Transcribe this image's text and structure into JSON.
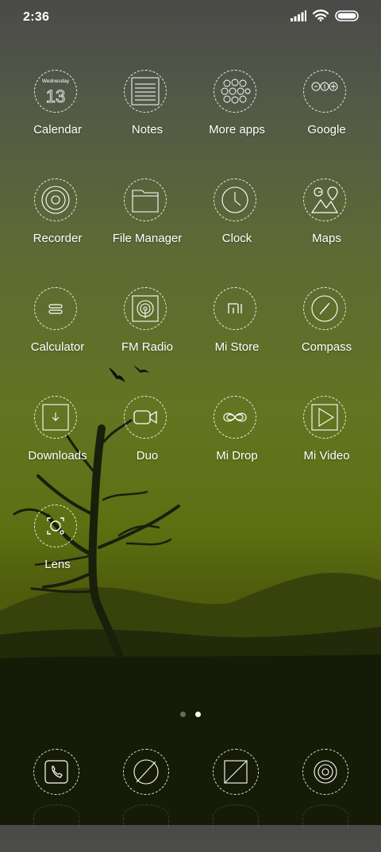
{
  "status_bar": {
    "time": "2:36",
    "icons": [
      "signal-icon",
      "wifi-icon",
      "battery-icon"
    ]
  },
  "home": {
    "apps": [
      {
        "label": "Calendar",
        "icon": "calendar-icon",
        "calendar_day": "Wednesday",
        "calendar_date": "13"
      },
      {
        "label": "Notes",
        "icon": "notes-icon"
      },
      {
        "label": "More apps",
        "icon": "apps-folder-icon"
      },
      {
        "label": "Google",
        "icon": "google-folder-icon"
      },
      {
        "label": "Recorder",
        "icon": "recorder-icon"
      },
      {
        "label": "File Manager",
        "icon": "folder-icon"
      },
      {
        "label": "Clock",
        "icon": "clock-icon"
      },
      {
        "label": "Maps",
        "icon": "maps-icon"
      },
      {
        "label": "Calculator",
        "icon": "calculator-icon"
      },
      {
        "label": "FM Radio",
        "icon": "radio-icon"
      },
      {
        "label": "Mi Store",
        "icon": "mi-store-icon"
      },
      {
        "label": "Compass",
        "icon": "compass-icon"
      },
      {
        "label": "Downloads",
        "icon": "download-icon"
      },
      {
        "label": "Duo",
        "icon": "video-camera-icon"
      },
      {
        "label": "Mi Drop",
        "icon": "mi-drop-icon"
      },
      {
        "label": "Mi Video",
        "icon": "play-icon"
      },
      {
        "label": "Lens",
        "icon": "lens-icon"
      }
    ]
  },
  "page_indicator": {
    "pages": 2,
    "current": 2
  },
  "dock": {
    "apps": [
      {
        "icon": "phone-icon"
      },
      {
        "icon": "browser-icon"
      },
      {
        "icon": "messaging-icon"
      },
      {
        "icon": "camera-icon"
      }
    ]
  }
}
